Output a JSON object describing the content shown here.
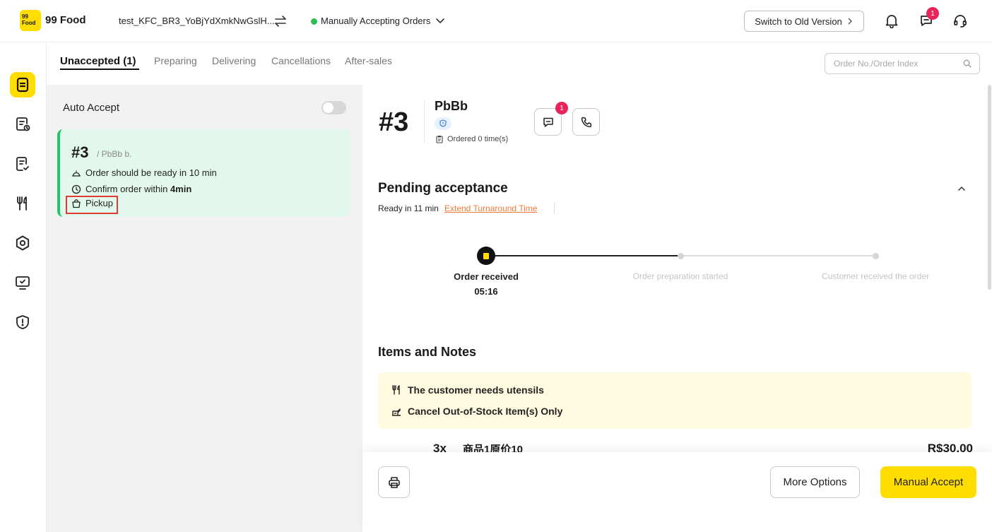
{
  "header": {
    "logo_text": "99 Food",
    "brand": "99 Food",
    "store_name": "test_KFC_BR3_YoBjYdXmkNwGslH...",
    "status": "Manually Accepting Orders",
    "status_color": "#2dbf4e",
    "switch_label": "Switch to Old Version",
    "message_badge": "1",
    "icons": [
      "swap-icon",
      "chevron-down-icon",
      "bell-icon",
      "message-icon",
      "headset-icon"
    ]
  },
  "sidebar": {
    "items": [
      {
        "name": "orders",
        "icon": "orders-icon",
        "active": true
      },
      {
        "name": "order-history",
        "icon": "receipt-clock-icon"
      },
      {
        "name": "reviews",
        "icon": "checklist-icon"
      },
      {
        "name": "menu",
        "icon": "utensils-icon"
      },
      {
        "name": "settings",
        "icon": "gear-icon"
      },
      {
        "name": "monitor",
        "icon": "monitor-check-icon"
      },
      {
        "name": "security",
        "icon": "shield-alert-icon"
      }
    ]
  },
  "tabs": [
    {
      "label": "Unaccepted (1)",
      "active": true
    },
    {
      "label": "Preparing"
    },
    {
      "label": "Delivering"
    },
    {
      "label": "Cancellations"
    },
    {
      "label": "After-sales"
    }
  ],
  "search": {
    "placeholder": "Order No./Order Index",
    "value": ""
  },
  "left": {
    "auto_accept_label": "Auto Accept",
    "auto_accept_on": false,
    "order_card": {
      "number": "#3",
      "customer": "/ PbBb b.",
      "ready_text": "Order should be ready in 10 min",
      "confirm_prefix": "Confirm order within ",
      "confirm_time": "4min",
      "type": "Pickup"
    }
  },
  "detail": {
    "order_number": "#3",
    "customer_name": "PbBb",
    "ordered_times": "Ordered 0 time(s)",
    "chat_badge": "1",
    "pending_title": "Pending acceptance",
    "ready_in": "Ready in 11 min",
    "extend_link": "Extend Turnaround Time",
    "timeline": [
      {
        "label": "Order received",
        "time": "05:16",
        "done": true
      },
      {
        "label": "Order preparation started",
        "done": false
      },
      {
        "label": "Customer received the order",
        "done": false
      }
    ],
    "items_title": "Items and Notes",
    "notes": [
      {
        "icon": "utensils-icon",
        "text": "The customer needs utensils"
      },
      {
        "icon": "box-icon",
        "text": "Cancel Out-of-Stock Item(s) Only"
      }
    ],
    "items": [
      {
        "qty": "3x",
        "name": "商品1原价10",
        "price": "R$30,00"
      }
    ]
  },
  "footer": {
    "print_icon": "printer-icon",
    "more_options": "More Options",
    "manual_accept": "Manual Accept",
    "accent": "#FFDD00"
  }
}
